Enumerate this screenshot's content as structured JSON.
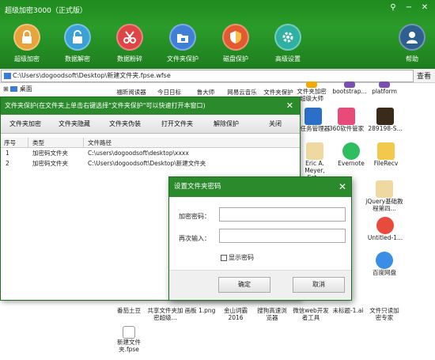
{
  "app": {
    "title": "超级加密3000（正式版）",
    "colors": {
      "toolbar_green": "#2a9c2a",
      "dialog_green": "#2b8a2b"
    }
  },
  "toolbar": {
    "items": [
      {
        "label": "超级加密",
        "icon": "lock-icon",
        "color": "#e8a33a"
      },
      {
        "label": "数据解密",
        "icon": "unlock-icon",
        "color": "#3aa0d8"
      },
      {
        "label": "数据粉碎",
        "icon": "scissors-icon",
        "color": "#e04545"
      },
      {
        "label": "文件夹保护",
        "icon": "folder-lock-icon",
        "color": "#3f7fd8"
      },
      {
        "label": "磁盘保护",
        "icon": "shield-icon",
        "color": "#e35a30"
      },
      {
        "label": "高级设置",
        "icon": "gear-icon",
        "color": "#30b0a0"
      },
      {
        "label": "帮助",
        "icon": "user-help-icon",
        "color": "#2d5f8f"
      }
    ]
  },
  "pathbar": {
    "path": "C:\\Users\\dogoodsoft\\Desktop\\新建文件夹.fpse.wfse",
    "search_label": "查看"
  },
  "tree": {
    "root_label": "桌面"
  },
  "desktop_labels": [
    "福昕阅读器",
    "今日日标",
    "鲁大师",
    "网易云音乐",
    "文件夹保护",
    "文件夹加密超级大师",
    "bootstrap...",
    "platform",
    "0任务管理器",
    "360软件管家",
    "289198-S...",
    "Eric A. Meyer, Est...",
    "Evernote",
    "FileRecv",
    "jQuery基础教程第四...",
    "Untitled-1...",
    "百度网盘",
    "番茄土豆",
    "共享文件夹加密超级...",
    "画板 1.png",
    "金山词霸2016",
    "搜狗高速浏览器",
    "微信web开发者工具",
    "未标题-1.ai",
    "文件只读加密专家",
    "新建文件夹.fpse"
  ],
  "folder_protect_window": {
    "title": "文件夹保护(在文件夹上单击右键选择\"文件夹保护\"可以快速打开本窗口)",
    "buttons": [
      "文件夹加密",
      "文件夹隐藏",
      "文件夹伪装",
      "打开文件夹",
      "解除保护",
      "关闭"
    ],
    "columns": [
      "序号",
      "类型",
      "文件路径"
    ],
    "rows": [
      {
        "no": "1",
        "type": "加密码文件夹",
        "path": "C:\\users\\dogoodsoft\\desktop\\xxxx"
      },
      {
        "no": "2",
        "type": "加密码文件夹",
        "path": "C:\\Users\\dogoodsoft\\Desktop\\新建文件夹"
      }
    ]
  },
  "password_dialog": {
    "title": "设置文件夹密码",
    "password_label": "加密密码：",
    "confirm_label": "再次输入：",
    "password_value": "",
    "confirm_value": "",
    "show_password_label": "显示密码",
    "show_password_checked": false,
    "ok_label": "确定",
    "cancel_label": "取消"
  }
}
